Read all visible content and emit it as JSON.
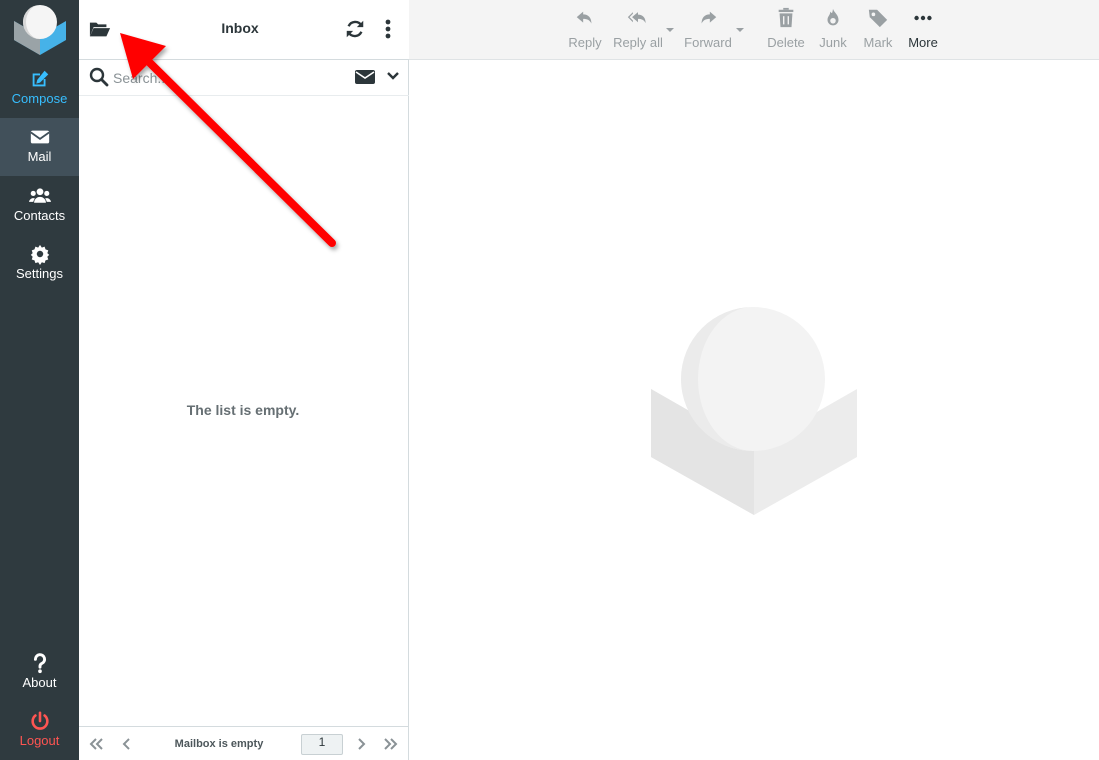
{
  "nav": {
    "compose": "Compose",
    "mail": "Mail",
    "contacts": "Contacts",
    "settings": "Settings",
    "about": "About",
    "logout": "Logout"
  },
  "list": {
    "title": "Inbox",
    "search_placeholder": "Search...",
    "empty_message": "The list is empty.",
    "footer_status": "Mailbox is empty",
    "page_number": "1"
  },
  "toolbar": {
    "reply": "Reply",
    "reply_all": "Reply all",
    "forward": "Forward",
    "delete": "Delete",
    "junk": "Junk",
    "mark": "Mark",
    "more": "More"
  },
  "colors": {
    "nav_bg": "#2f3a3f",
    "nav_active_bg": "#41505a",
    "compose_accent": "#37beff",
    "logout_accent": "#ff5552",
    "annotation_arrow": "#ff0000"
  },
  "icons": [
    "logo-icon",
    "compose-icon",
    "mail-icon",
    "contacts-icon",
    "settings-icon",
    "about-icon",
    "logout-icon",
    "folder-open-icon",
    "refresh-icon",
    "menu-dots-icon",
    "search-icon",
    "envelope-icon",
    "chevron-down-icon",
    "reply-icon",
    "reply-all-icon",
    "forward-icon",
    "trash-icon",
    "junk-flame-icon",
    "tag-icon",
    "more-dots-icon",
    "first-page-icon",
    "prev-page-icon",
    "next-page-icon",
    "last-page-icon"
  ]
}
